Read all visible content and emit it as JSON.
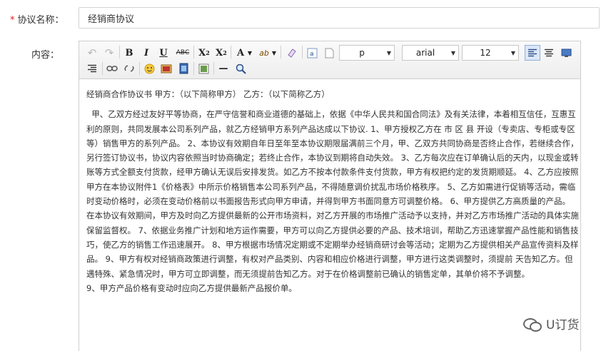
{
  "form": {
    "name_required_mark": "*",
    "name_label": "协议名称：",
    "name_value": "经销商协议",
    "content_label": "内容："
  },
  "toolbar": {
    "undo_icon": "↶",
    "redo_icon": "↷",
    "bold": "B",
    "italic": "I",
    "underline": "U",
    "strikethrough": "ABC",
    "superscript_base": "X",
    "superscript_mark": "2",
    "subscript_base": "X",
    "subscript_mark": "2",
    "font_color": "A",
    "highlight": "ab",
    "format_value": "p",
    "font_value": "arial",
    "size_value": "12",
    "ruler_icon": "—",
    "zoom_icon": "🔍"
  },
  "content": {
    "title_line": "经销商合作协议书 甲方：（以下简称甲方） 乙方：（以下简称乙方）",
    "body": "  甲、乙双方经过友好平等协商，在严守信誉和商业道德的基础上，依据《中华人民共和国合同法》及有关法律，本着相互信任，互惠互利的原则，共同发展本公司系列产品，就乙方经销甲方系列产品达成以下协议. 1、甲方授权乙方在 市 区 县 开设（专卖店、专柜或专区等）销售甲方的系列产品。 2、本协议有效期自年日至年至本协议期限届满前三个月，甲、乙双方共同协商是否终止合作，若继续合作，另行签订协议书，协议内容依照当时协商确定；若终止合作，本协议到期将自动失效。 3、乙方每次应在订单确认后的天内，以现金或转账等方式全额支付货款，经甲方确认无误后安排发货。如乙方不按本付款条件支付货款，甲方有权把约定的发货期顺延。 4、乙方应按照甲方在本协议附件1《价格表》中所示价格销售本公司系列产品，不得随意调价扰乱市场价格秩序。 5、乙方如需进行促销等活动，需临时变动价格时，必须在变动价格前以书面报告形式向甲方申请，并得到甲方书面同意方可调整价格。 6、甲方提供乙方高质量的产品。 在本协议有效期间，甲方及时向乙方提供最新的公开市场资料，对乙方开展的市场推广活动予以支持，并对乙方市场推广活动的具体实施保留监督权。 7、依据业务推广计划和地方运作需要，甲方可以向乙方提供必要的产品、技术培训，帮助乙方迅速掌握产品性能和销售技巧，使乙方的销售工作迅速展开。 8、甲方根据市场情况定期或不定期举办经销商研讨会等活动；定期为乙方提供相关产品宣传资料及样品。 9、甲方有权对经销商政策进行调整，有权对产品类别、内容和相应价格进行调整，甲方进行这类调整时，须提前 天告知乙方。但遇特殊、紧急情况时，甲方可立即调整，而无须提前告知乙方。对于在价格调整前已确认的销售定单，其单价将不予调整。",
    "last_line": "9、甲方产品价格有变动时应向乙方提供最新产品报价单。"
  },
  "watermark": {
    "text": "U订货"
  },
  "colors": {
    "required": "#e02020",
    "border": "#d4d4d4",
    "toolbar_bg": "#eeeeee",
    "active_bg": "#dce8f7"
  }
}
